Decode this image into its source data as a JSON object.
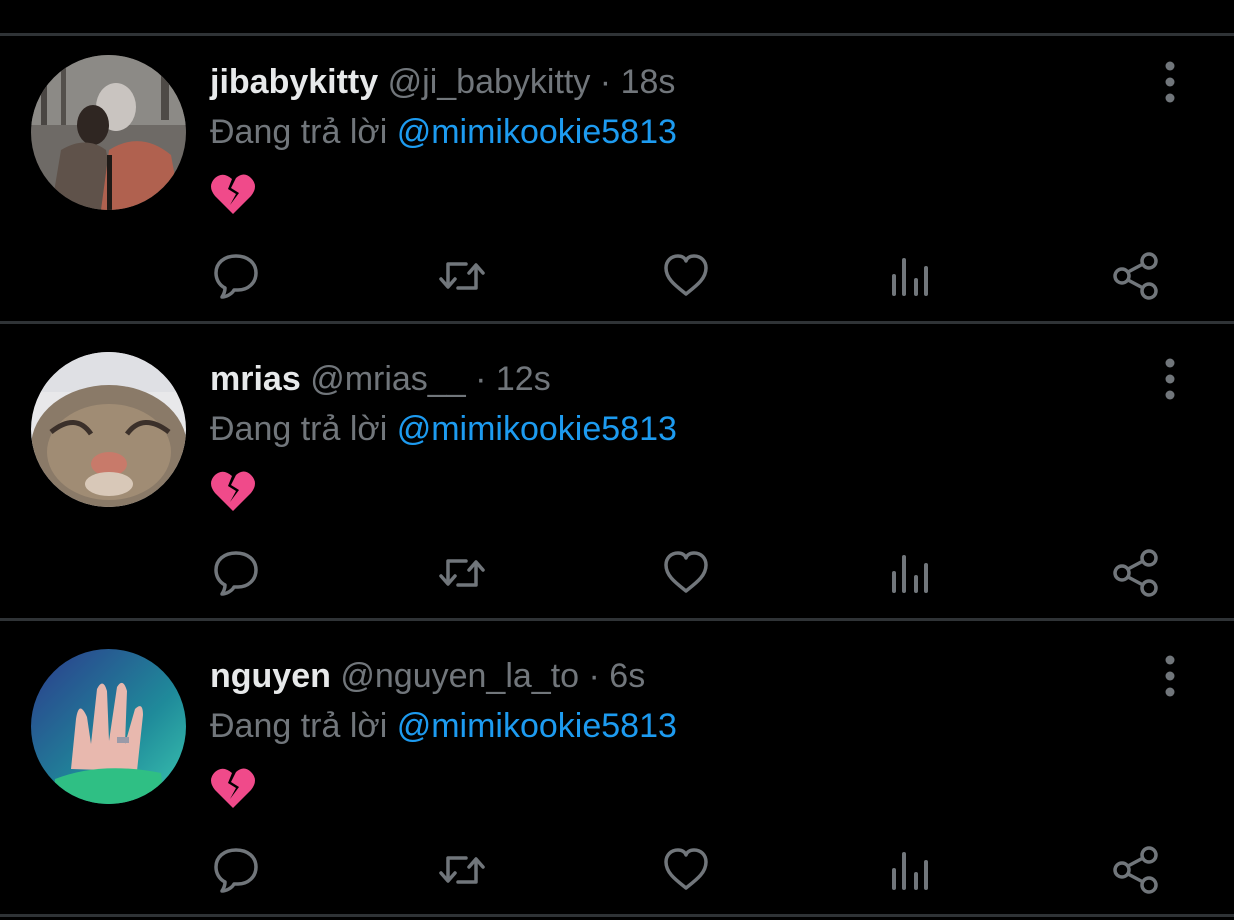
{
  "reply_label": "Đang trả lời",
  "colors": {
    "background": "#000000",
    "divider": "#2f3336",
    "text_primary": "#e7e9ea",
    "text_secondary": "#71767b",
    "accent": "#1d9bf0",
    "heart_broken": "#f04a8a"
  },
  "actions": [
    {
      "name": "reply",
      "icon": "comment-icon"
    },
    {
      "name": "retweet",
      "icon": "retweet-icon"
    },
    {
      "name": "like",
      "icon": "heart-icon"
    },
    {
      "name": "analytics",
      "icon": "analytics-icon"
    },
    {
      "name": "share",
      "icon": "share-icon"
    }
  ],
  "tweets": [
    {
      "display_name": "jibabykitty",
      "handle": "@ji_babykitty",
      "separator": "·",
      "time": "18s",
      "reply_to": "@mimikookie5813",
      "content_emoji": "broken-heart"
    },
    {
      "display_name": "mrias",
      "handle": "@mrias__",
      "separator": "·",
      "time": "12s",
      "reply_to": "@mimikookie5813",
      "content_emoji": "broken-heart"
    },
    {
      "display_name": "nguyen",
      "handle": "@nguyen_la_to",
      "separator": "·",
      "time": "6s",
      "reply_to": "@mimikookie5813",
      "content_emoji": "broken-heart"
    }
  ]
}
